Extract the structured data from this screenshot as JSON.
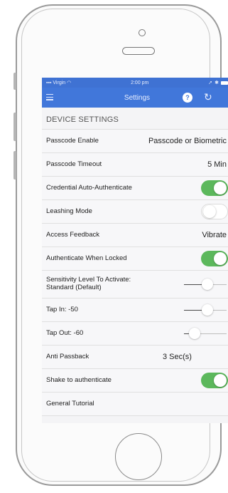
{
  "status_bar": {
    "carrier": "Virgin",
    "time": "2:00 pm"
  },
  "nav": {
    "title": "Settings"
  },
  "section": {
    "header": "DEVICE SETTINGS"
  },
  "rows": [
    {
      "label": "Passcode Enable",
      "value": "Passcode or Biometric"
    },
    {
      "label": "Passcode Timeout",
      "value": "5 Min"
    },
    {
      "label": "Credential Auto-Authenticate",
      "toggle": true
    },
    {
      "label": "Leashing Mode",
      "toggle": false
    },
    {
      "label": "Access Feedback",
      "value": "Vibrate"
    },
    {
      "label": "Authenticate When Locked",
      "toggle": true
    },
    {
      "label": "Sensitivity Level To Activate:",
      "label2": "Standard (Default)",
      "slider": 0.55
    },
    {
      "label": "Tap In: -50",
      "slider": 0.55
    },
    {
      "label": "Tap Out: -60",
      "slider": 0.25
    },
    {
      "label": "Anti Passback",
      "value": "3 Sec(s)"
    },
    {
      "label": "Shake to authenticate",
      "toggle": true
    },
    {
      "label": "General Tutorial"
    }
  ],
  "colors": {
    "accent": "#4177da",
    "toggle_on": "#5cb85c"
  },
  "icons": [
    "menu-icon",
    "help-icon",
    "refresh-icon",
    "wifi-icon",
    "battery-icon"
  ]
}
